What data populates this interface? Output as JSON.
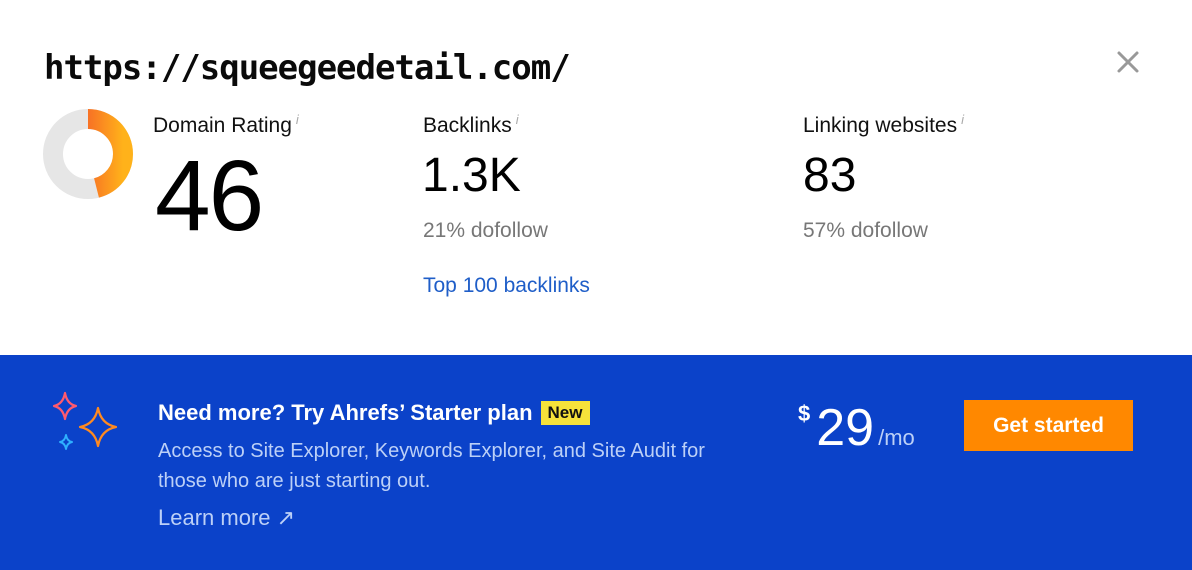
{
  "header": {
    "url": "https://squeegeedetail.com/"
  },
  "domain_rating": {
    "label": "Domain Rating",
    "info": "i",
    "value": "46",
    "fraction": 0.46
  },
  "backlinks": {
    "label": "Backlinks",
    "info": "i",
    "value": "1.3K",
    "dofollow": "21% dofollow",
    "link": "Top 100 backlinks"
  },
  "linking_websites": {
    "label": "Linking websites",
    "info": "i",
    "value": "83",
    "dofollow": "57% dofollow"
  },
  "promo": {
    "title": "Need more? Try Ahrefs’ Starter plan",
    "badge": "New",
    "description": "Access to Site Explorer, Keywords Explorer, and Site Audit for those who are just starting out.",
    "learn_more": "Learn more ↗",
    "currency": "$",
    "price": "29",
    "period": "/mo",
    "cta": "Get started"
  },
  "colors": {
    "banner": "#0b42c9",
    "cta": "#ff8800",
    "link": "#1f5ec8",
    "badge": "#f6e23a"
  },
  "icons": {
    "close": "close-icon",
    "sparkles": "sparkles-icon"
  }
}
